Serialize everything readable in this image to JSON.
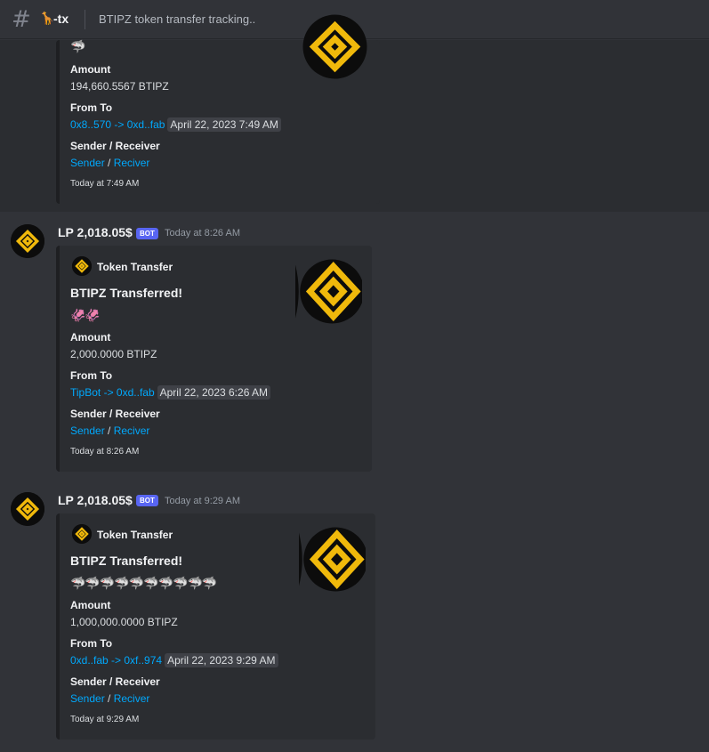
{
  "header": {
    "channel_emoji": "🦒",
    "channel_name": "-tx",
    "topic": "BTIPZ token transfer tracking.."
  },
  "messages": [
    {
      "embed": {
        "emojis": "🦈",
        "amount_label": "Amount",
        "amount": "194,660.5567 BTIPZ",
        "fromto_label": "From To",
        "from": "0x8..570",
        "arrow": " -> ",
        "to": "0xd..fab",
        "timestamp": "April 22, 2023 7:49 AM",
        "sr_label": "Sender / Receiver",
        "sender": "Sender",
        "sep": " / ",
        "receiver": "Reciver",
        "footer": "Today at 7:49 AM"
      }
    },
    {
      "username": "LP 2,018.05$",
      "bot_tag": "BOT",
      "time": "Today at 8:26 AM",
      "embed": {
        "author": "Token Transfer",
        "title": "BTIPZ Transferred!",
        "emojis": "🦑🦑",
        "amount_label": "Amount",
        "amount": "2,000.0000 BTIPZ",
        "fromto_label": "From To",
        "from": "TipBot",
        "arrow": " -> ",
        "to": "0xd..fab",
        "timestamp": "April 22, 2023 6:26 AM",
        "sr_label": "Sender / Receiver",
        "sender": "Sender",
        "sep": " / ",
        "receiver": "Reciver",
        "footer": "Today at 8:26 AM"
      }
    },
    {
      "username": "LP 2,018.05$",
      "bot_tag": "BOT",
      "time": "Today at 9:29 AM",
      "embed": {
        "author": "Token Transfer",
        "title": "BTIPZ Transferred!",
        "emojis": "🦈🦈🦈🦈🦈🦈🦈🦈🦈🦈",
        "amount_label": "Amount",
        "amount": "1,000,000.0000 BTIPZ",
        "fromto_label": "From To",
        "from": "0xd..fab",
        "arrow": " -> ",
        "to": "0xf..974",
        "timestamp": "April 22, 2023 9:29 AM",
        "sr_label": "Sender / Receiver",
        "sender": "Sender",
        "sep": " / ",
        "receiver": "Reciver",
        "footer": "Today at 9:29 AM"
      }
    }
  ],
  "colors": {
    "bnb_gold": "#f0b90b",
    "link": "#00a8fc",
    "bot_tag": "#5865f2"
  },
  "icons": {
    "hash": "hash-icon",
    "logo": "bnb-logo-icon"
  }
}
